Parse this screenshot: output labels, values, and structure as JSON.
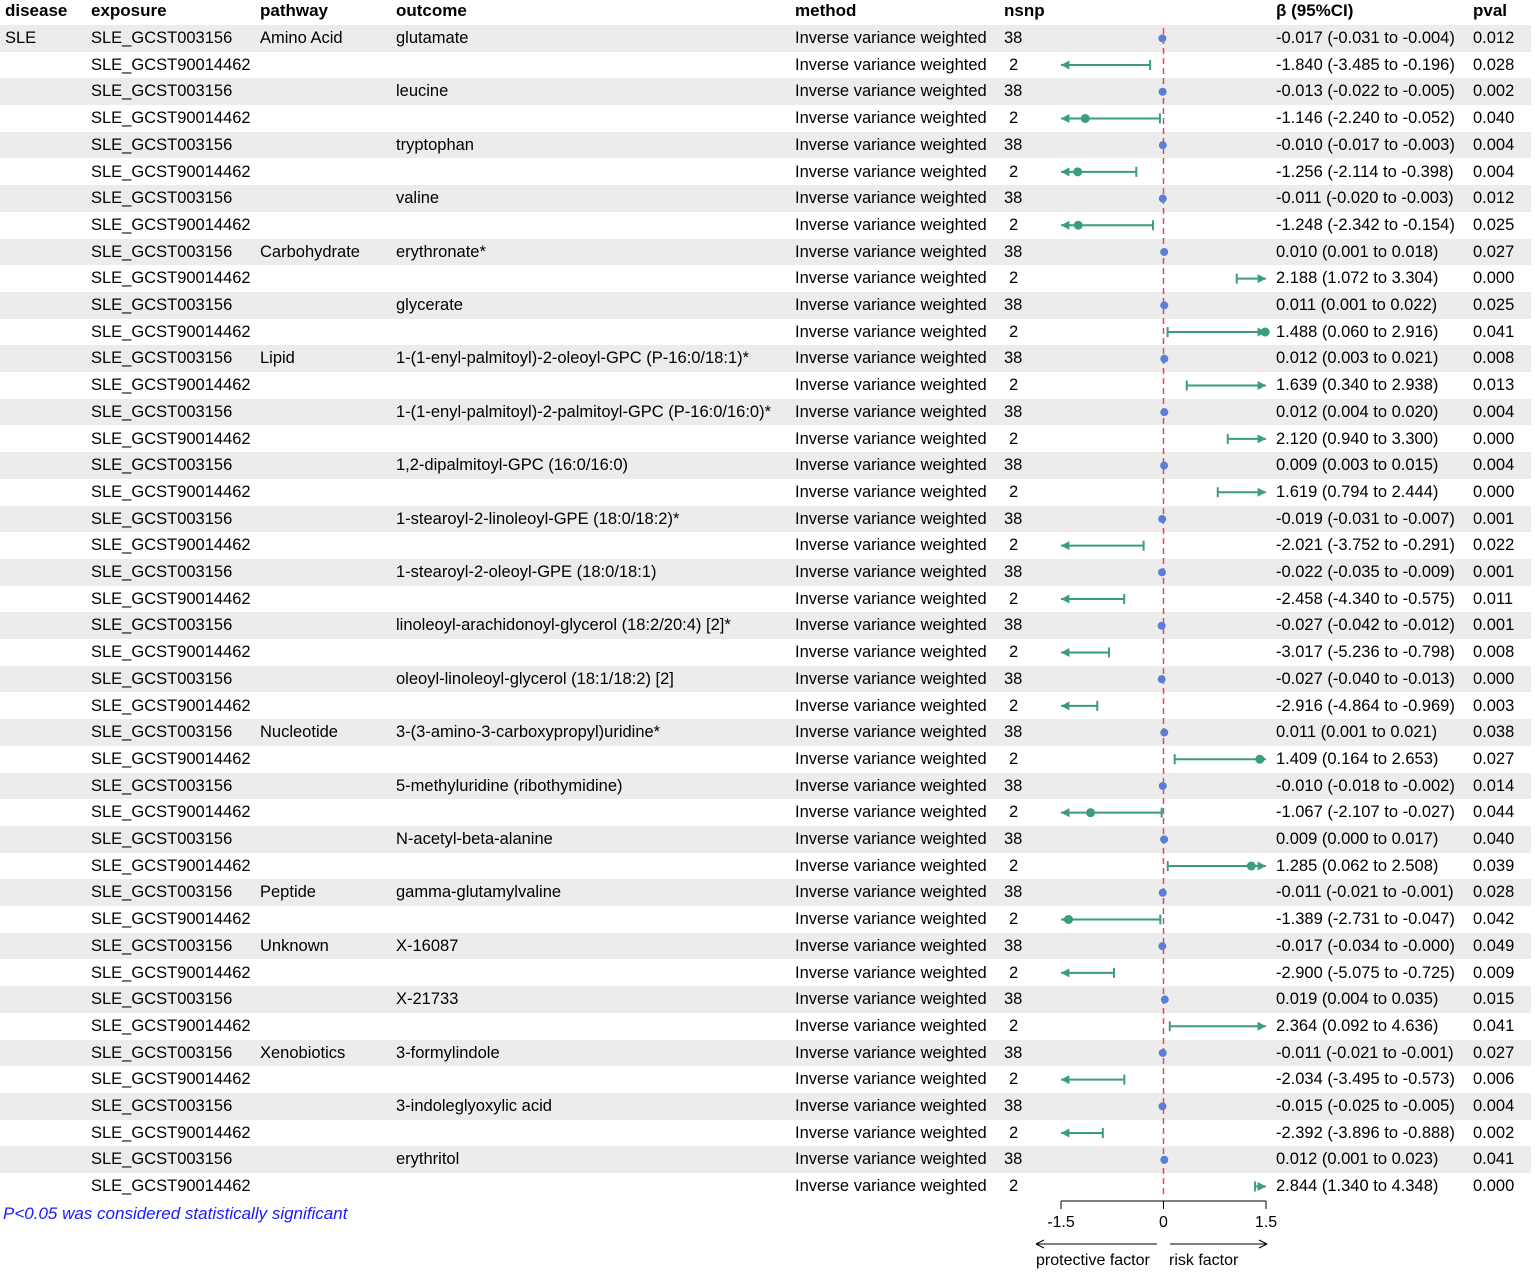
{
  "headers": {
    "disease": "disease",
    "exposure": "exposure",
    "pathway": "pathway",
    "outcome": "outcome",
    "method": "method",
    "nsnp": "nsnp",
    "beta": "β (95%CI)",
    "pval": "pval"
  },
  "rows": [
    {
      "disease": "SLE",
      "exposure": "SLE_GCST003156",
      "pathway": "Amino Acid",
      "outcome": "glutamate",
      "method": "Inverse variance weighted",
      "nsnp": "38",
      "ci": "-0.017 (-0.031 to -0.004)",
      "pval": "0.012"
    },
    {
      "disease": "",
      "exposure": "SLE_GCST90014462",
      "pathway": "",
      "outcome": "",
      "method": "Inverse variance weighted",
      "nsnp": "2",
      "ci": "-1.840 (-3.485 to -0.196)",
      "pval": "0.028"
    },
    {
      "disease": "",
      "exposure": "SLE_GCST003156",
      "pathway": "",
      "outcome": "leucine",
      "method": "Inverse variance weighted",
      "nsnp": "38",
      "ci": "-0.013 (-0.022 to -0.005)",
      "pval": "0.002"
    },
    {
      "disease": "",
      "exposure": "SLE_GCST90014462",
      "pathway": "",
      "outcome": "",
      "method": "Inverse variance weighted",
      "nsnp": "2",
      "ci": "-1.146 (-2.240 to -0.052)",
      "pval": "0.040"
    },
    {
      "disease": "",
      "exposure": "SLE_GCST003156",
      "pathway": "",
      "outcome": "tryptophan",
      "method": "Inverse variance weighted",
      "nsnp": "38",
      "ci": "-0.010 (-0.017 to -0.003)",
      "pval": "0.004"
    },
    {
      "disease": "",
      "exposure": "SLE_GCST90014462",
      "pathway": "",
      "outcome": "",
      "method": "Inverse variance weighted",
      "nsnp": "2",
      "ci": "-1.256 (-2.114 to -0.398)",
      "pval": "0.004"
    },
    {
      "disease": "",
      "exposure": "SLE_GCST003156",
      "pathway": "",
      "outcome": "valine",
      "method": "Inverse variance weighted",
      "nsnp": "38",
      "ci": "-0.011 (-0.020 to -0.003)",
      "pval": "0.012"
    },
    {
      "disease": "",
      "exposure": "SLE_GCST90014462",
      "pathway": "",
      "outcome": "",
      "method": "Inverse variance weighted",
      "nsnp": "2",
      "ci": "-1.248 (-2.342 to -0.154)",
      "pval": "0.025"
    },
    {
      "disease": "",
      "exposure": "SLE_GCST003156",
      "pathway": "Carbohydrate",
      "outcome": "erythronate*",
      "method": "Inverse variance weighted",
      "nsnp": "38",
      "ci": "0.010 (0.001 to 0.018)",
      "pval": "0.027"
    },
    {
      "disease": "",
      "exposure": "SLE_GCST90014462",
      "pathway": "",
      "outcome": "",
      "method": "Inverse variance weighted",
      "nsnp": "2",
      "ci": "2.188 (1.072 to 3.304)",
      "pval": "0.000"
    },
    {
      "disease": "",
      "exposure": "SLE_GCST003156",
      "pathway": "",
      "outcome": "glycerate",
      "method": "Inverse variance weighted",
      "nsnp": "38",
      "ci": "0.011 (0.001 to 0.022)",
      "pval": "0.025"
    },
    {
      "disease": "",
      "exposure": "SLE_GCST90014462",
      "pathway": "",
      "outcome": "",
      "method": "Inverse variance weighted",
      "nsnp": "2",
      "ci": "1.488 (0.060 to 2.916)",
      "pval": "0.041"
    },
    {
      "disease": "",
      "exposure": "SLE_GCST003156",
      "pathway": "Lipid",
      "outcome": "1-(1-enyl-palmitoyl)-2-oleoyl-GPC (P-16:0/18:1)*",
      "method": "Inverse variance weighted",
      "nsnp": "38",
      "ci": "0.012 (0.003 to 0.021)",
      "pval": "0.008"
    },
    {
      "disease": "",
      "exposure": "SLE_GCST90014462",
      "pathway": "",
      "outcome": "",
      "method": "Inverse variance weighted",
      "nsnp": "2",
      "ci": "1.639 (0.340 to 2.938)",
      "pval": "0.013"
    },
    {
      "disease": "",
      "exposure": "SLE_GCST003156",
      "pathway": "",
      "outcome": "1-(1-enyl-palmitoyl)-2-palmitoyl-GPC (P-16:0/16:0)*",
      "method": "Inverse variance weighted",
      "nsnp": "38",
      "ci": "0.012 (0.004 to 0.020)",
      "pval": "0.004"
    },
    {
      "disease": "",
      "exposure": "SLE_GCST90014462",
      "pathway": "",
      "outcome": "",
      "method": "Inverse variance weighted",
      "nsnp": "2",
      "ci": "2.120 (0.940 to 3.300)",
      "pval": "0.000"
    },
    {
      "disease": "",
      "exposure": "SLE_GCST003156",
      "pathway": "",
      "outcome": "1,2-dipalmitoyl-GPC (16:0/16:0)",
      "method": "Inverse variance weighted",
      "nsnp": "38",
      "ci": "0.009 (0.003 to 0.015)",
      "pval": "0.004"
    },
    {
      "disease": "",
      "exposure": "SLE_GCST90014462",
      "pathway": "",
      "outcome": "",
      "method": "Inverse variance weighted",
      "nsnp": "2",
      "ci": "1.619 (0.794 to 2.444)",
      "pval": "0.000"
    },
    {
      "disease": "",
      "exposure": "SLE_GCST003156",
      "pathway": "",
      "outcome": "1-stearoyl-2-linoleoyl-GPE (18:0/18:2)*",
      "method": "Inverse variance weighted",
      "nsnp": "38",
      "ci": "-0.019 (-0.031 to -0.007)",
      "pval": "0.001"
    },
    {
      "disease": "",
      "exposure": "SLE_GCST90014462",
      "pathway": "",
      "outcome": "",
      "method": "Inverse variance weighted",
      "nsnp": "2",
      "ci": "-2.021 (-3.752 to -0.291)",
      "pval": "0.022"
    },
    {
      "disease": "",
      "exposure": "SLE_GCST003156",
      "pathway": "",
      "outcome": "1-stearoyl-2-oleoyl-GPE (18:0/18:1)",
      "method": "Inverse variance weighted",
      "nsnp": "38",
      "ci": "-0.022 (-0.035 to -0.009)",
      "pval": "0.001"
    },
    {
      "disease": "",
      "exposure": "SLE_GCST90014462",
      "pathway": "",
      "outcome": "",
      "method": "Inverse variance weighted",
      "nsnp": "2",
      "ci": "-2.458 (-4.340 to -0.575)",
      "pval": "0.011"
    },
    {
      "disease": "",
      "exposure": "SLE_GCST003156",
      "pathway": "",
      "outcome": "linoleoyl-arachidonoyl-glycerol (18:2/20:4) [2]*",
      "method": "Inverse variance weighted",
      "nsnp": "38",
      "ci": "-0.027 (-0.042 to -0.012)",
      "pval": "0.001"
    },
    {
      "disease": "",
      "exposure": "SLE_GCST90014462",
      "pathway": "",
      "outcome": "",
      "method": "Inverse variance weighted",
      "nsnp": "2",
      "ci": "-3.017 (-5.236 to -0.798)",
      "pval": "0.008"
    },
    {
      "disease": "",
      "exposure": "SLE_GCST003156",
      "pathway": "",
      "outcome": "oleoyl-linoleoyl-glycerol (18:1/18:2) [2]",
      "method": "Inverse variance weighted",
      "nsnp": "38",
      "ci": "-0.027 (-0.040 to -0.013)",
      "pval": "0.000"
    },
    {
      "disease": "",
      "exposure": "SLE_GCST90014462",
      "pathway": "",
      "outcome": "",
      "method": "Inverse variance weighted",
      "nsnp": "2",
      "ci": "-2.916 (-4.864 to -0.969)",
      "pval": "0.003"
    },
    {
      "disease": "",
      "exposure": "SLE_GCST003156",
      "pathway": "Nucleotide",
      "outcome": "3-(3-amino-3-carboxypropyl)uridine*",
      "method": "Inverse variance weighted",
      "nsnp": "38",
      "ci": "0.011 (0.001 to 0.021)",
      "pval": "0.038"
    },
    {
      "disease": "",
      "exposure": "SLE_GCST90014462",
      "pathway": "",
      "outcome": "",
      "method": "Inverse variance weighted",
      "nsnp": "2",
      "ci": "1.409 (0.164 to 2.653)",
      "pval": "0.027"
    },
    {
      "disease": "",
      "exposure": "SLE_GCST003156",
      "pathway": "",
      "outcome": "5-methyluridine (ribothymidine)",
      "method": "Inverse variance weighted",
      "nsnp": "38",
      "ci": "-0.010 (-0.018 to -0.002)",
      "pval": "0.014"
    },
    {
      "disease": "",
      "exposure": "SLE_GCST90014462",
      "pathway": "",
      "outcome": "",
      "method": "Inverse variance weighted",
      "nsnp": "2",
      "ci": "-1.067 (-2.107 to -0.027)",
      "pval": "0.044"
    },
    {
      "disease": "",
      "exposure": "SLE_GCST003156",
      "pathway": "",
      "outcome": "N-acetyl-beta-alanine",
      "method": "Inverse variance weighted",
      "nsnp": "38",
      "ci": "0.009 (0.000 to 0.017)",
      "pval": "0.040"
    },
    {
      "disease": "",
      "exposure": "SLE_GCST90014462",
      "pathway": "",
      "outcome": "",
      "method": "Inverse variance weighted",
      "nsnp": "2",
      "ci": "1.285 (0.062 to 2.508)",
      "pval": "0.039"
    },
    {
      "disease": "",
      "exposure": "SLE_GCST003156",
      "pathway": "Peptide",
      "outcome": "gamma-glutamylvaline",
      "method": "Inverse variance weighted",
      "nsnp": "38",
      "ci": "-0.011 (-0.021 to -0.001)",
      "pval": "0.028"
    },
    {
      "disease": "",
      "exposure": "SLE_GCST90014462",
      "pathway": "",
      "outcome": "",
      "method": "Inverse variance weighted",
      "nsnp": "2",
      "ci": "-1.389 (-2.731 to -0.047)",
      "pval": "0.042"
    },
    {
      "disease": "",
      "exposure": "SLE_GCST003156",
      "pathway": "Unknown",
      "outcome": "X-16087",
      "method": "Inverse variance weighted",
      "nsnp": "38",
      "ci": "-0.017 (-0.034 to -0.000)",
      "pval": "0.049"
    },
    {
      "disease": "",
      "exposure": "SLE_GCST90014462",
      "pathway": "",
      "outcome": "",
      "method": "Inverse variance weighted",
      "nsnp": "2",
      "ci": "-2.900 (-5.075 to -0.725)",
      "pval": "0.009"
    },
    {
      "disease": "",
      "exposure": "SLE_GCST003156",
      "pathway": "",
      "outcome": "X-21733",
      "method": "Inverse variance weighted",
      "nsnp": "38",
      "ci": "0.019 (0.004 to 0.035)",
      "pval": "0.015"
    },
    {
      "disease": "",
      "exposure": "SLE_GCST90014462",
      "pathway": "",
      "outcome": "",
      "method": "Inverse variance weighted",
      "nsnp": "2",
      "ci": "2.364 (0.092 to 4.636)",
      "pval": "0.041"
    },
    {
      "disease": "",
      "exposure": "SLE_GCST003156",
      "pathway": "Xenobiotics",
      "outcome": "3-formylindole",
      "method": "Inverse variance weighted",
      "nsnp": "38",
      "ci": "-0.011 (-0.021 to -0.001)",
      "pval": "0.027"
    },
    {
      "disease": "",
      "exposure": "SLE_GCST90014462",
      "pathway": "",
      "outcome": "",
      "method": "Inverse variance weighted",
      "nsnp": "2",
      "ci": "-2.034 (-3.495 to -0.573)",
      "pval": "0.006"
    },
    {
      "disease": "",
      "exposure": "SLE_GCST003156",
      "pathway": "",
      "outcome": "3-indoleglyoxylic acid",
      "method": "Inverse variance weighted",
      "nsnp": "38",
      "ci": "-0.015 (-0.025 to -0.005)",
      "pval": "0.004"
    },
    {
      "disease": "",
      "exposure": "SLE_GCST90014462",
      "pathway": "",
      "outcome": "",
      "method": "Inverse variance weighted",
      "nsnp": "2",
      "ci": "-2.392 (-3.896 to -0.888)",
      "pval": "0.002"
    },
    {
      "disease": "",
      "exposure": "SLE_GCST003156",
      "pathway": "",
      "outcome": "erythritol",
      "method": "Inverse variance weighted",
      "nsnp": "38",
      "ci": "0.012 (0.001 to 0.023)",
      "pval": "0.041"
    },
    {
      "disease": "",
      "exposure": "SLE_GCST90014462",
      "pathway": "",
      "outcome": "",
      "method": "Inverse variance weighted",
      "nsnp": "2",
      "ci": "2.844 (1.340 to 4.348)",
      "pval": "0.000"
    }
  ],
  "footnote": "P<0.05 was considered statistically significant",
  "chart_data": {
    "type": "forest",
    "xlim": [
      -1.5,
      1.5
    ],
    "x_ticks": [
      "-1.5",
      "0",
      "1.5"
    ],
    "reference_line": 0,
    "reference_line_color": "#e8474b",
    "marker_color": "#3a9e7e",
    "reference_marker_color": "#5b7fd6",
    "clipped_arrows": true,
    "left_label": "protective factor",
    "right_label": "risk factor",
    "estimates": [
      [
        -0.017,
        -0.031,
        -0.004
      ],
      [
        -1.84,
        -3.485,
        -0.196
      ],
      [
        -0.013,
        -0.022,
        -0.005
      ],
      [
        -1.146,
        -2.24,
        -0.052
      ],
      [
        -0.01,
        -0.017,
        -0.003
      ],
      [
        -1.256,
        -2.114,
        -0.398
      ],
      [
        -0.011,
        -0.02,
        -0.003
      ],
      [
        -1.248,
        -2.342,
        -0.154
      ],
      [
        0.01,
        0.001,
        0.018
      ],
      [
        2.188,
        1.072,
        3.304
      ],
      [
        0.011,
        0.001,
        0.022
      ],
      [
        1.488,
        0.06,
        2.916
      ],
      [
        0.012,
        0.003,
        0.021
      ],
      [
        1.639,
        0.34,
        2.938
      ],
      [
        0.012,
        0.004,
        0.02
      ],
      [
        2.12,
        0.94,
        3.3
      ],
      [
        0.009,
        0.003,
        0.015
      ],
      [
        1.619,
        0.794,
        2.444
      ],
      [
        -0.019,
        -0.031,
        -0.007
      ],
      [
        -2.021,
        -3.752,
        -0.291
      ],
      [
        -0.022,
        -0.035,
        -0.009
      ],
      [
        -2.458,
        -4.34,
        -0.575
      ],
      [
        -0.027,
        -0.042,
        -0.012
      ],
      [
        -3.017,
        -5.236,
        -0.798
      ],
      [
        -0.027,
        -0.04,
        -0.013
      ],
      [
        -2.916,
        -4.864,
        -0.969
      ],
      [
        0.011,
        0.001,
        0.021
      ],
      [
        1.409,
        0.164,
        2.653
      ],
      [
        -0.01,
        -0.018,
        -0.002
      ],
      [
        -1.067,
        -2.107,
        -0.027
      ],
      [
        0.009,
        0.0,
        0.017
      ],
      [
        1.285,
        0.062,
        2.508
      ],
      [
        -0.011,
        -0.021,
        -0.001
      ],
      [
        -1.389,
        -2.731,
        -0.047
      ],
      [
        -0.017,
        -0.034,
        -0.0
      ],
      [
        -2.9,
        -5.075,
        -0.725
      ],
      [
        0.019,
        0.004,
        0.035
      ],
      [
        2.364,
        0.092,
        4.636
      ],
      [
        -0.011,
        -0.021,
        -0.001
      ],
      [
        -2.034,
        -3.495,
        -0.573
      ],
      [
        -0.015,
        -0.025,
        -0.005
      ],
      [
        -2.392,
        -3.896,
        -0.888
      ],
      [
        0.012,
        0.001,
        0.023
      ],
      [
        2.844,
        1.34,
        4.348
      ]
    ]
  }
}
